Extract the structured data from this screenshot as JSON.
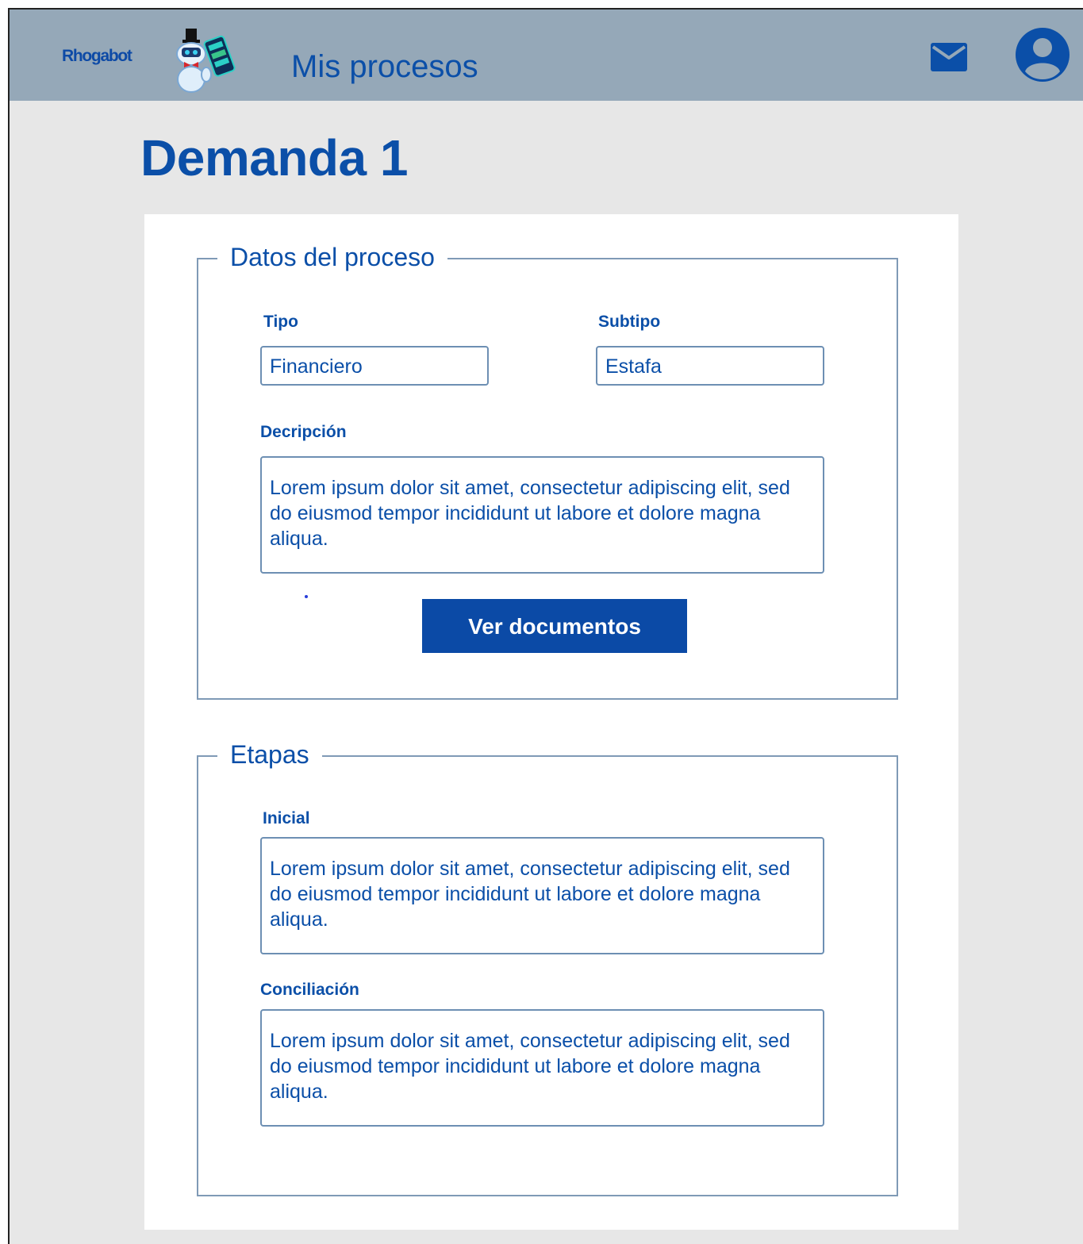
{
  "header": {
    "brand": "Rhogabot",
    "nav_title": "Mis procesos",
    "icons": [
      "mail-icon",
      "account-circle-icon"
    ],
    "background_color": "#95a8b8"
  },
  "page": {
    "title": "Demanda 1"
  },
  "process_data": {
    "legend": "Datos del proceso",
    "type_label": "Tipo",
    "type_value": "Financiero",
    "subtype_label": "Subtipo",
    "subtype_value": "Estafa",
    "description_label": "Decripción",
    "description_value": "Lorem ipsum dolor sit amet, consectetur adipiscing elit, sed do eiusmod tempor incididunt ut labore et dolore magna aliqua.",
    "documents_button": "Ver documentos"
  },
  "stages": {
    "legend": "Etapas",
    "items": [
      {
        "label": "Inicial",
        "text": "Lorem ipsum dolor sit amet, consectetur adipiscing elit, sed do eiusmod tempor incididunt ut labore et dolore magna aliqua."
      },
      {
        "label": "Conciliación",
        "text": "Lorem ipsum dolor sit amet, consectetur adipiscing elit, sed do eiusmod tempor incididunt ut labore et dolore magna aliqua."
      }
    ]
  },
  "colors": {
    "primary": "#0b4fa8",
    "button": "#0b4aa6",
    "page_background": "#e7e7e7",
    "card_background": "#ffffff",
    "border": "#7f9ab6"
  }
}
